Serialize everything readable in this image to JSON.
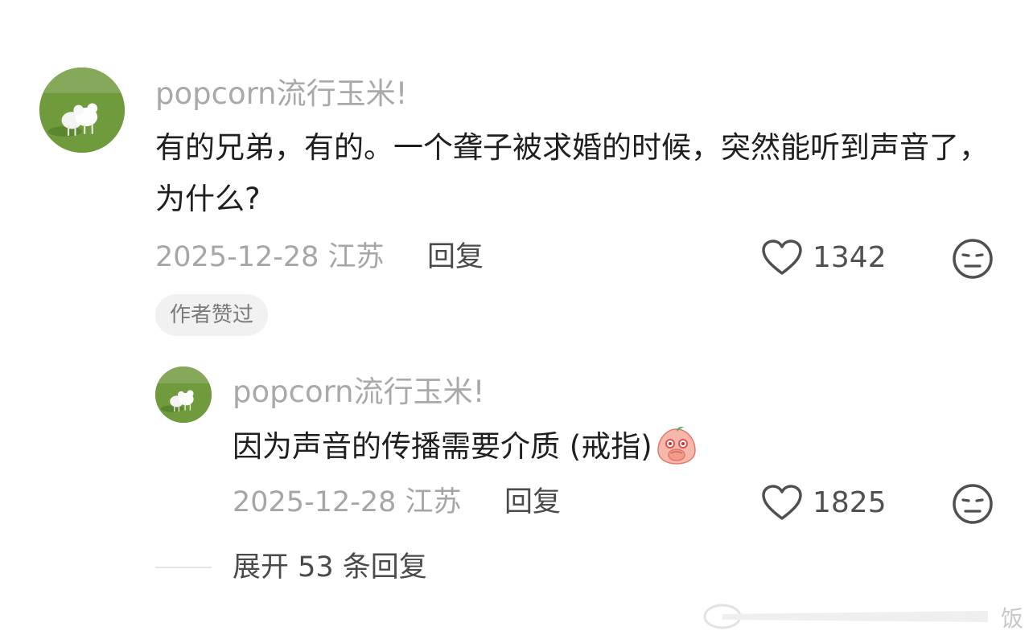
{
  "comments": [
    {
      "username": "popcorn流行玉米!",
      "text": "有的兄弟，有的。一个聋子被求婚的时候，突然能听到声音了，为什么?",
      "date_location": "2025-12-28 江苏",
      "reply_label": "回复",
      "like_count": "1342",
      "badge": "作者赞过"
    }
  ],
  "replies": [
    {
      "username": "popcorn流行玉米!",
      "text": "因为声音的传播需要介质 (戒指)",
      "emoji": "covering-mouth-laugh-emoji",
      "date_location": "2025-12-28 江苏",
      "reply_label": "回复",
      "like_count": "1825"
    }
  ],
  "expand_replies": "展开 53 条回复",
  "watermark": "饭",
  "icons": {
    "like": "heart-outline-icon",
    "dislike": "meh-face-icon",
    "avatar": "lambs-avatar"
  }
}
